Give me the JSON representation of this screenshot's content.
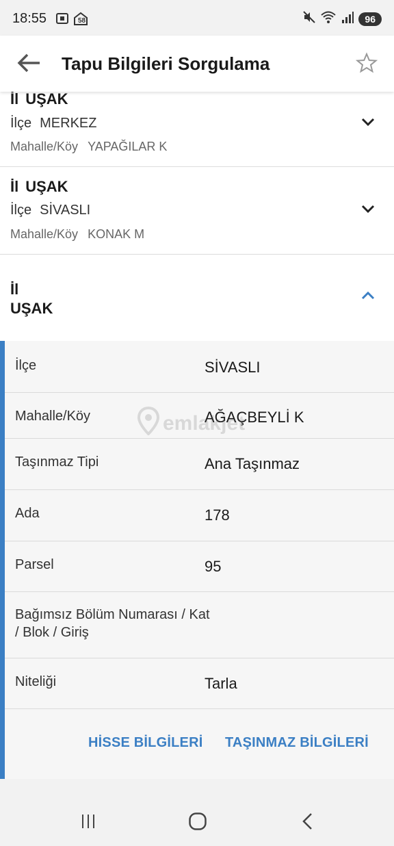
{
  "status_bar": {
    "time": "18:55",
    "notification_badge": "58",
    "battery": "96",
    "icons": [
      "screenshot-icon",
      "home-notification-icon",
      "mute-icon",
      "wifi-icon",
      "signal-icon"
    ]
  },
  "app_bar": {
    "title": "Tapu Bilgileri Sorgulama",
    "back_icon": "arrow-left-icon",
    "favorite_icon": "star-outline-icon"
  },
  "colors": {
    "accent": "#3b7fc4",
    "background": "#f2f2f2",
    "detail_background": "#f6f6f6"
  },
  "records": [
    {
      "il_label": "İl",
      "il_value": "UŞAK",
      "ilce_label": "İlçe",
      "ilce_value": "MERKEZ",
      "mahalle_label": "Mahalle/Köy",
      "mahalle_value": "YAPAĞILAR K",
      "expanded": false
    },
    {
      "il_label": "İl",
      "il_value": "UŞAK",
      "ilce_label": "İlçe",
      "ilce_value": "SİVASLI",
      "mahalle_label": "Mahalle/Köy",
      "mahalle_value": "KONAK M",
      "expanded": false
    }
  ],
  "expanded_record": {
    "il_label": "İl",
    "il_value": "UŞAK",
    "expanded": true,
    "details": [
      {
        "label": "İlçe",
        "value": "SİVASLI"
      },
      {
        "label": "Mahalle/Köy",
        "value": "AĞAÇBEYLİ K"
      },
      {
        "label": "Taşınmaz Tipi",
        "value": "Ana Taşınmaz"
      },
      {
        "label": "Ada",
        "value": "178"
      },
      {
        "label": "Parsel",
        "value": "95"
      },
      {
        "label": "Bağımsız Bölüm Numarası / Kat / Blok / Giriş",
        "value": ""
      },
      {
        "label": "Niteliği",
        "value": "Tarla"
      }
    ],
    "actions": {
      "hisse": "HİSSE BİLGİLERİ",
      "tasinmaz": "TAŞINMAZ BİLGİLERİ"
    }
  },
  "watermark": "emlakjet",
  "nav_bar": {
    "icons": [
      "recent-apps-icon",
      "home-icon",
      "back-icon"
    ]
  }
}
